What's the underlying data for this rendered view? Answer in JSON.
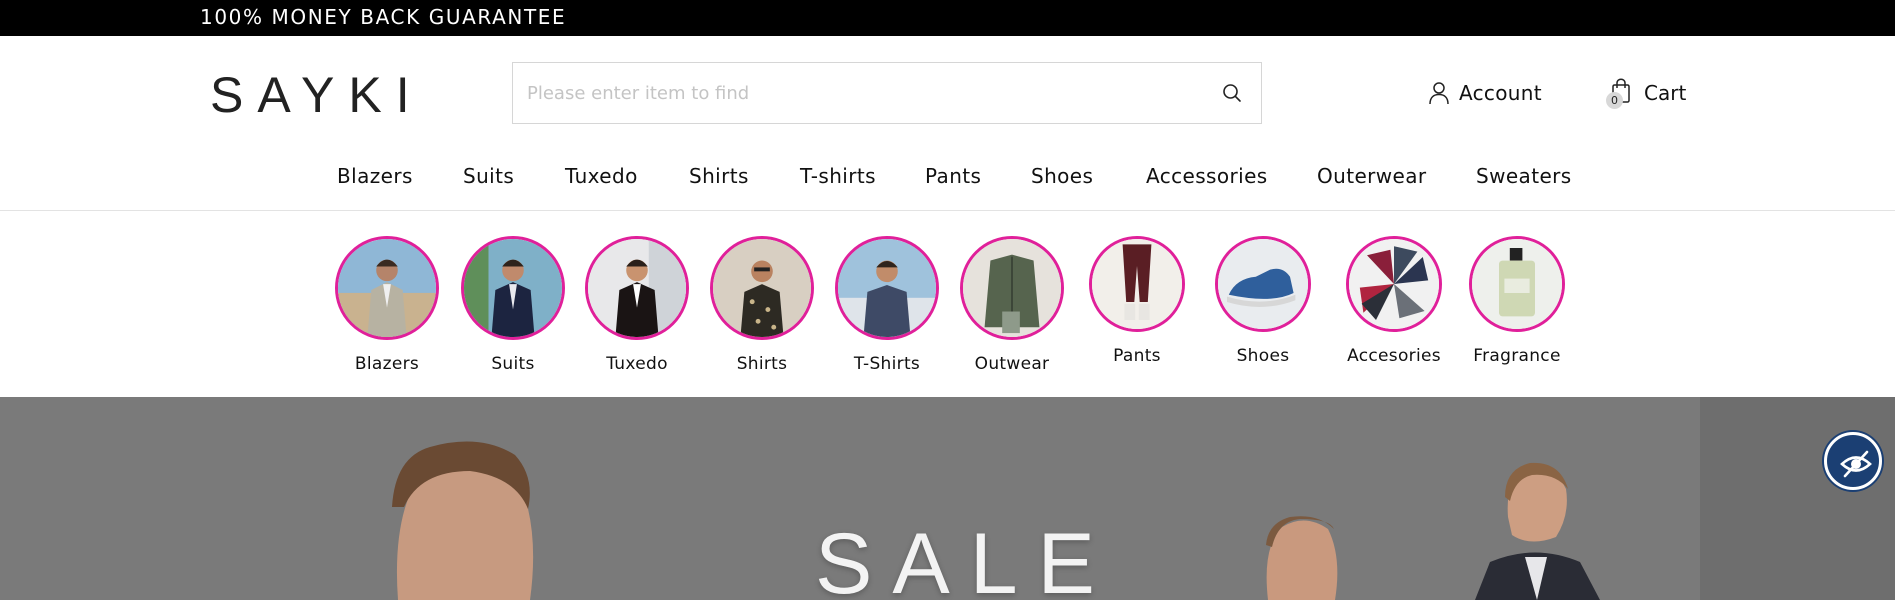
{
  "promo_bar": {
    "text": "100% MONEY BACK GUARANTEE"
  },
  "header": {
    "logo": "SAYKI",
    "search": {
      "placeholder": "Please enter item to find",
      "value": ""
    },
    "account_label": "Account",
    "cart_label": "Cart",
    "cart_count": "0"
  },
  "nav": {
    "items": [
      "Blazers",
      "Suits",
      "Tuxedo",
      "Shirts",
      "T-shirts",
      "Pants",
      "Shoes",
      "Accessories",
      "Outerwear",
      "Sweaters"
    ]
  },
  "categories": {
    "items": [
      "Blazers",
      "Suits",
      "Tuxedo",
      "Shirts",
      "T-Shirts",
      "Outwear",
      "Pants",
      "Shoes",
      "Accesories",
      "Fragrance"
    ]
  },
  "banner": {
    "headline": "SALE"
  },
  "icons": {
    "search": "search-icon",
    "account": "user-icon",
    "cart": "shopping-bag-icon",
    "accessibility": "eye-slash-icon"
  },
  "colors": {
    "promo_bar_bg": "#000000",
    "category_ring": "#e0209a",
    "banner_bg": "#7b7b7b",
    "accessibility_button": "#1b3f73"
  }
}
